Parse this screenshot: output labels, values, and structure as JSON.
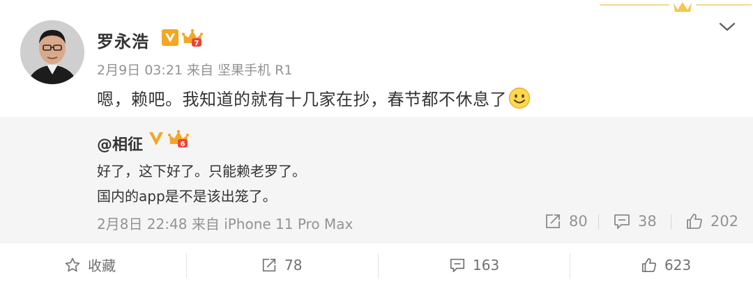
{
  "post": {
    "username": "罗永浩",
    "vip_level": "7",
    "date": "2月9日 03:21",
    "source_prefix": "来自",
    "source": "坚果手机 R1",
    "text": "嗯，赖吧。我知道的就有十几家在抄，春节都不休息了"
  },
  "repost": {
    "username": "@相征",
    "vip_level": "6",
    "line1": "好了，这下好了。只能赖老罗了。",
    "line2": "国内的app是不是该出笼了。",
    "date": "2月8日 22:48",
    "source_prefix": "来自",
    "source": "iPhone 11 Pro Max",
    "reposts": "80",
    "comments": "38",
    "likes": "202"
  },
  "actions": {
    "favorite": "收藏",
    "reposts": "78",
    "comments": "163",
    "likes": "623"
  },
  "colors": {
    "verified_orange": "#f5a623",
    "crown_red": "#e8463b",
    "meta_gray": "#939393",
    "repost_bg": "#f5f5f5",
    "deco_gold": "#f3c84b"
  },
  "icons": {
    "verified": "verified-v-icon",
    "vip": "vip-crown-icon",
    "more": "chevron-down-icon",
    "repost": "share-arrow-icon",
    "comment": "comment-icon",
    "like": "thumbs-up-icon",
    "favorite": "star-icon",
    "emoji": "smiley-icon"
  }
}
